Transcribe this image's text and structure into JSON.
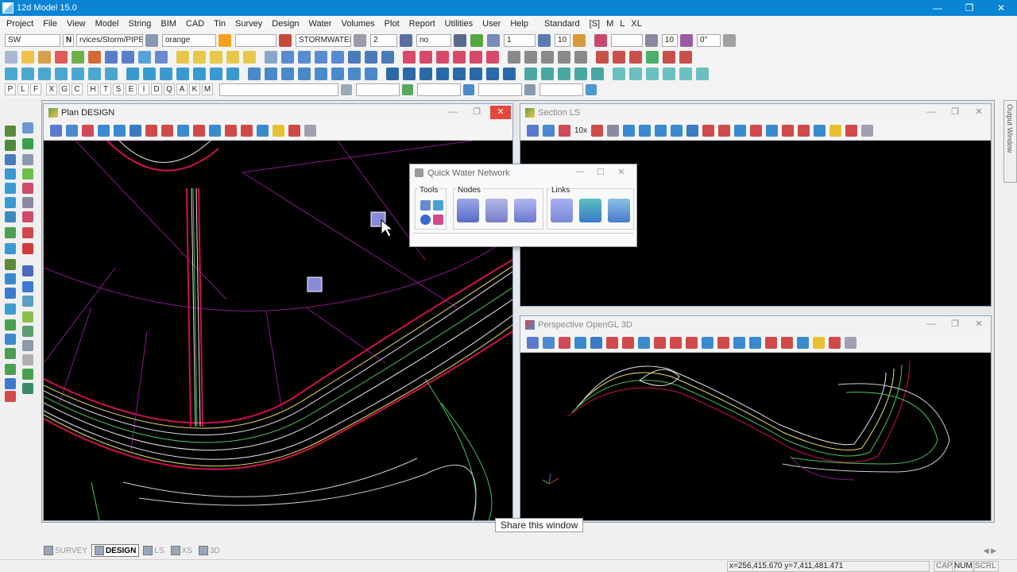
{
  "app": {
    "title": "12d Model 15.0"
  },
  "menu": [
    "Project",
    "File",
    "View",
    "Model",
    "String",
    "BIM",
    "CAD",
    "Tin",
    "Survey",
    "Design",
    "Water",
    "Volumes",
    "Plot",
    "Report",
    "Utilities",
    "User",
    "Help",
    "Standard",
    "[S]",
    "M",
    "L",
    "XL"
  ],
  "toolbar": {
    "field_sw": "SW",
    "field_n": "N",
    "field_path": "rvices/Storm/PIPE",
    "field_colour": "orange",
    "field_model": "STORMWATER",
    "field_weight": "2",
    "field_style": "no",
    "field_one": "1",
    "field_ten_a": "10",
    "field_ten_b": "10",
    "field_angle": "0°",
    "accent_colour": "#f7a21b"
  },
  "letter_buttons": [
    "P",
    "L",
    "F",
    "X",
    "G",
    "C",
    "H",
    "T",
    "S",
    "E",
    "I",
    "D",
    "Q",
    "A",
    "K",
    "M"
  ],
  "plan": {
    "title": "Plan DESIGN",
    "colors": {
      "road_red": "#d0104c",
      "road_white": "#e6e6e6",
      "road_green": "#49c45a",
      "road_yellow": "#e8e35a",
      "magenta": "#8a1a8a"
    }
  },
  "section": {
    "title": "Section LS",
    "zoom_label": "10x"
  },
  "persp": {
    "title": "Perspective OpenGL 3D"
  },
  "qwn": {
    "title": "Quick Water Network",
    "group_tools": "Tools",
    "group_nodes": "Nodes",
    "group_links": "Links"
  },
  "tooltip": "Share this window",
  "tabs": [
    "SURVEY",
    "DESIGN",
    "LS",
    "XS",
    "3D"
  ],
  "status": {
    "coords": "x=256,415.670 y=7,411,481.471",
    "cap": "CAP",
    "num": "NUM",
    "scrl": "SCRL"
  },
  "output_window": "Output Window"
}
